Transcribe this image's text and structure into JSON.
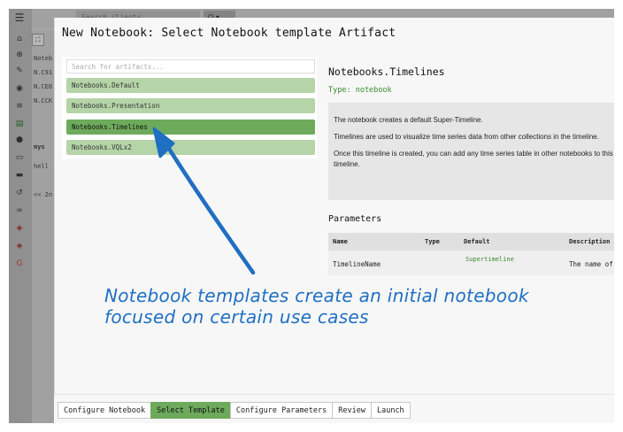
{
  "background": {
    "search_placeholder": "Search clients",
    "search_button": "Q ▾",
    "sidebar_icons": [
      "menu-icon",
      "home-icon",
      "crosshair-icon",
      "wrench-icon",
      "eye-icon",
      "server-icon",
      "notebook-icon",
      "user-icon",
      "monitor-icon",
      "folder-icon",
      "history-icon",
      "binoculars-icon",
      "shield-icon",
      "shield-icon",
      "google-icon"
    ],
    "list_rows": [
      "Noteb",
      "N.C91",
      "N.CE6",
      "N.CCK",
      "mys",
      "hell",
      "<< 2n"
    ]
  },
  "modal": {
    "title": "New Notebook: Select Notebook template Artifact",
    "search_placeholder": "Search for artifacts...",
    "artifacts": [
      {
        "label": "Notebooks.Default",
        "selected": false
      },
      {
        "label": "Notebooks.Presentation",
        "selected": false
      },
      {
        "label": "Notebooks.Timelines",
        "selected": true
      },
      {
        "label": "Notebooks.VQLx2",
        "selected": false
      }
    ],
    "detail": {
      "name": "Notebooks.Timelines",
      "type": "Type: notebook",
      "description": [
        "The notebook creates a default Super-Timeline.",
        "Timelines are used to visualize time series data from other collections in the timeline.",
        "Once this timeline is created, you can add any time series table in other notebooks to this timeline."
      ]
    },
    "parameters": {
      "heading": "Parameters",
      "columns": [
        "Name",
        "Type",
        "Default",
        "Description"
      ],
      "rows": [
        {
          "name": "TimelineName",
          "type": "",
          "default": "Supertimeline",
          "description": "The name of"
        }
      ]
    }
  },
  "annotation": {
    "line1": "Notebook templates create an initial notebook",
    "line2": "focused on certain use cases",
    "color": "#1f6fc2"
  },
  "footer": {
    "tabs": [
      {
        "label": "Configure Notebook",
        "active": false
      },
      {
        "label": "Select Template",
        "active": true
      },
      {
        "label": "Configure Parameters",
        "active": false
      },
      {
        "label": "Review",
        "active": false
      },
      {
        "label": "Launch",
        "active": false
      }
    ]
  },
  "colors": {
    "accent_green": "#6daa5c",
    "light_green": "#b5d4a8",
    "type_green": "#3a8a2e"
  }
}
